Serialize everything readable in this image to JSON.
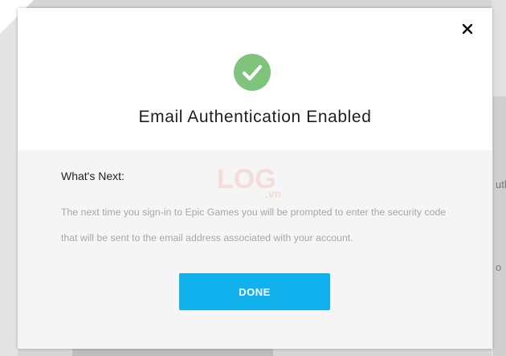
{
  "modal": {
    "title": "Email Authentication Enabled",
    "next_heading": "What's Next:",
    "description": "The next time you sign-in to Epic Games you will be prompted to enter the security code that will be sent to the email address associated with your account.",
    "done_label": "DONE",
    "close_icon": "close-icon",
    "status_icon": "checkmark-circle-icon",
    "accent_color": "#11b1ee",
    "success_color": "#7fc47d"
  },
  "watermark": {
    "text": "LOG.vn"
  },
  "background": {
    "fragment_1": "uth",
    "fragment_2": "o"
  }
}
